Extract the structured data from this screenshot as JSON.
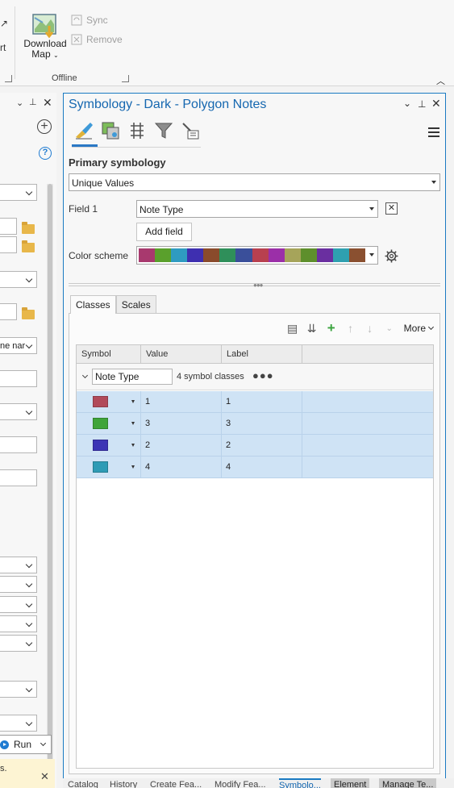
{
  "ribbon": {
    "left_clipped_label": "rt",
    "download_map": {
      "line1": "Download",
      "line2": "Map"
    },
    "sync_label": "Sync",
    "remove_label": "Remove",
    "offline_group_label": "Offline"
  },
  "left_pane": {
    "clipped_dropdown_text": "ne nar",
    "run_label": "Run",
    "message_text": "s."
  },
  "symbology": {
    "title": "Symbology - Dark - Polygon Notes",
    "tabs": [
      "primary-symbology-icon",
      "vary-symbology-icon",
      "label-classes-icon",
      "filter-icon",
      "settings-icon"
    ],
    "primary_label": "Primary symbology",
    "method": "Unique Values",
    "field1_label": "Field 1",
    "field1_value": "Note Type",
    "add_field_label": "Add field",
    "color_scheme_label": "Color scheme",
    "color_scheme": [
      "#a8396e",
      "#5aa02c",
      "#2f9bc1",
      "#3e2fb0",
      "#8a4b2c",
      "#2f8f5a",
      "#3a4f9a",
      "#b8404f",
      "#9b2fa8",
      "#a6a45a",
      "#5e8f2c",
      "#6a2fa0",
      "#2fa0b0",
      "#8a5030"
    ],
    "classes_tab": "Classes",
    "scales_tab": "Scales",
    "more_label": "More",
    "columns": {
      "symbol": "Symbol",
      "value": "Value",
      "label": "Label"
    },
    "group": {
      "field": "Note Type",
      "count_text": "4 symbol classes"
    },
    "classes": [
      {
        "color": "#b14a5a",
        "value": "1",
        "label": "1"
      },
      {
        "color": "#3fa43a",
        "value": "3",
        "label": "3"
      },
      {
        "color": "#3c34b5",
        "value": "2",
        "label": "2"
      },
      {
        "color": "#2e9bb5",
        "value": "4",
        "label": "4"
      }
    ]
  },
  "bottom_tabs": [
    "Catalog",
    "History",
    "Create Fea...",
    "Modify Fea...",
    "Symbolo...",
    "Element",
    "Manage Te..."
  ]
}
